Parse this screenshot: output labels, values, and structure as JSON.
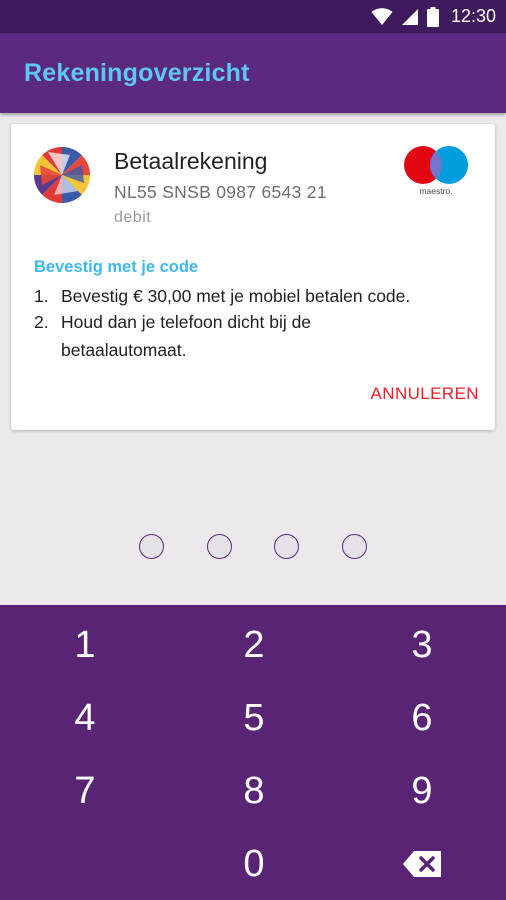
{
  "status_bar": {
    "time": "12:30",
    "icons": [
      "wifi-icon",
      "signal-icon",
      "battery-icon"
    ]
  },
  "app_bar": {
    "title": "Rekeningoverzicht"
  },
  "account": {
    "name": "Betaalrekening",
    "iban": "NL55 SNSB 0987 6543 21",
    "type": "debit",
    "card_brand": "maestro."
  },
  "confirm": {
    "heading": "Bevestig met je code",
    "steps": [
      {
        "num": "1.",
        "text": "Bevestig € 30,00 met je mobiel betalen code."
      },
      {
        "num": "2.",
        "text": "Houd dan je telefoon dicht bij de",
        "cont": "betaalautomaat."
      }
    ],
    "cancel_label": "ANNULEREN"
  },
  "pin": {
    "length": 4,
    "entered": 0
  },
  "keypad": {
    "keys": [
      "1",
      "2",
      "3",
      "4",
      "5",
      "6",
      "7",
      "8",
      "9",
      "0"
    ],
    "backspace_icon": "backspace-icon"
  },
  "colors": {
    "status_bar": "#3f1a5c",
    "app_bar": "#5b2a80",
    "title": "#5dc8f2",
    "heading": "#3fb8ee",
    "cancel": "#e8212a",
    "keypad": "#5a2475",
    "maestro_red": "#e30613",
    "maestro_blue": "#009ddd"
  }
}
